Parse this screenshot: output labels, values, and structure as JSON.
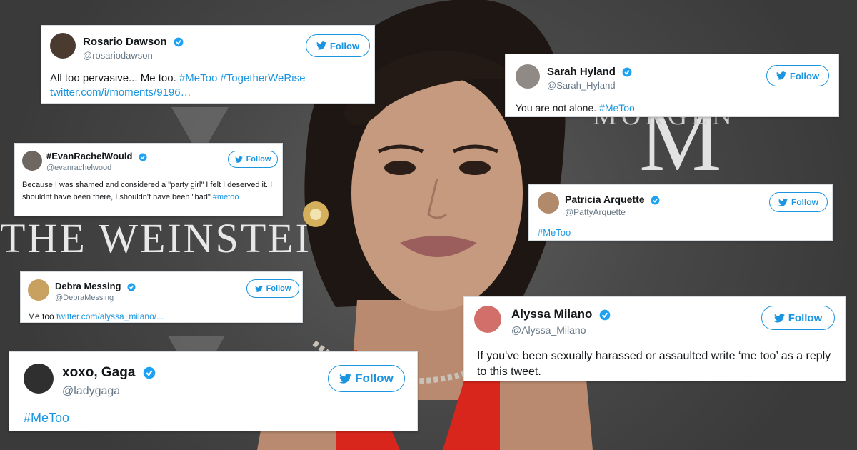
{
  "background": {
    "logo_text": "THE WEINSTEIN C",
    "logo_sub": "MORGEN",
    "logo_monogram": "M"
  },
  "follow_label": "Follow",
  "tweets": [
    {
      "name": "Rosario Dawson",
      "handle": "@rosariodawson",
      "text": "All too pervasive... Me too. ",
      "tags": "#MeToo #TogetherWeRise",
      "line2": "twitter.com/i/moments/9196…",
      "avatar_icon": "user-avatar-rosario"
    },
    {
      "name": "Sarah Hyland",
      "handle": "@Sarah_Hyland",
      "text": "You are not alone. ",
      "tags": "#MeToo",
      "avatar_icon": "user-avatar-sarah"
    },
    {
      "name": "#EvanRachelWould",
      "handle": "@evanrachelwood",
      "text": "Because I was shamed and considered a \"party girl\" I felt I deserved it. I shouldnt have been there, I shouldn't have been \"bad\" ",
      "tags": "#metoo",
      "avatar_icon": "user-avatar-evan"
    },
    {
      "name": "Patricia Arquette",
      "handle": "@PattyArquette",
      "text": "",
      "tags": "#MeToo",
      "avatar_icon": "user-avatar-patricia"
    },
    {
      "name": "Debra Messing",
      "handle": "@DebraMessing",
      "text": "Me too ",
      "tags": "twitter.com/alyssa_milano/...",
      "avatar_icon": "user-avatar-debra"
    },
    {
      "name": "Alyssa Milano",
      "handle": "@Alyssa_Milano",
      "text": "If you've been sexually harassed or assaulted write ‘me too’ as a reply to this tweet.",
      "tags": "",
      "avatar_icon": "user-avatar-alyssa"
    },
    {
      "name": "xoxo, Gaga",
      "handle": "@ladygaga",
      "text": "",
      "tags": "#MeToo",
      "avatar_icon": "user-avatar-gaga"
    }
  ],
  "colors": {
    "link": "#1b95e0",
    "verified": "#1da1f2",
    "dress": "#d8261c"
  }
}
